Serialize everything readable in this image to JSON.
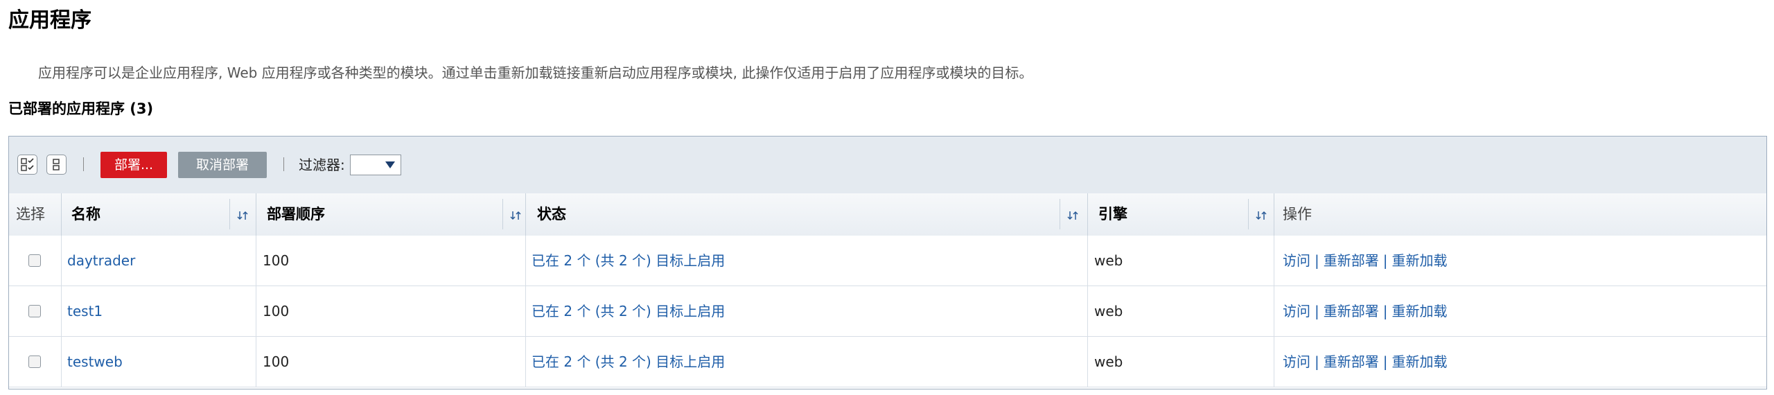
{
  "page": {
    "title": "应用程序",
    "description": "应用程序可以是企业应用程序, Web 应用程序或各种类型的模块。通过单击重新加载链接重新启动应用程序或模块, 此操作仅适用于启用了应用程序或模块的目标。",
    "section_title": "已部署的应用程序 (3)"
  },
  "toolbar": {
    "select_all_icon": "select-all-icon",
    "deselect_all_icon": "deselect-all-icon",
    "deploy_label": "部署...",
    "undeploy_label": "取消部署",
    "filter_label": "过滤器:",
    "filter_value": ""
  },
  "table": {
    "headers": {
      "select": "选择",
      "name": "名称",
      "order": "部署顺序",
      "status": "状态",
      "engine": "引擎",
      "actions": "操作"
    },
    "rows": [
      {
        "name": "daytrader",
        "order": "100",
        "status": "已在 2 个 (共 2 个) 目标上启用",
        "engine": "web",
        "checked": false
      },
      {
        "name": "test1",
        "order": "100",
        "status": "已在 2 个 (共 2 个) 目标上启用",
        "engine": "web",
        "checked": false
      },
      {
        "name": "testweb",
        "order": "100",
        "status": "已在 2 个 (共 2 个) 目标上启用",
        "engine": "web",
        "checked": false
      }
    ],
    "action_links": {
      "visit": "访问",
      "redeploy": "重新部署",
      "reload": "重新加载",
      "separator": "|"
    }
  },
  "colors": {
    "deploy_button": "#d71920",
    "undeploy_button": "#8c98a1",
    "link": "#1f5ea8",
    "toolbar_bg": "#e4eaf0"
  }
}
